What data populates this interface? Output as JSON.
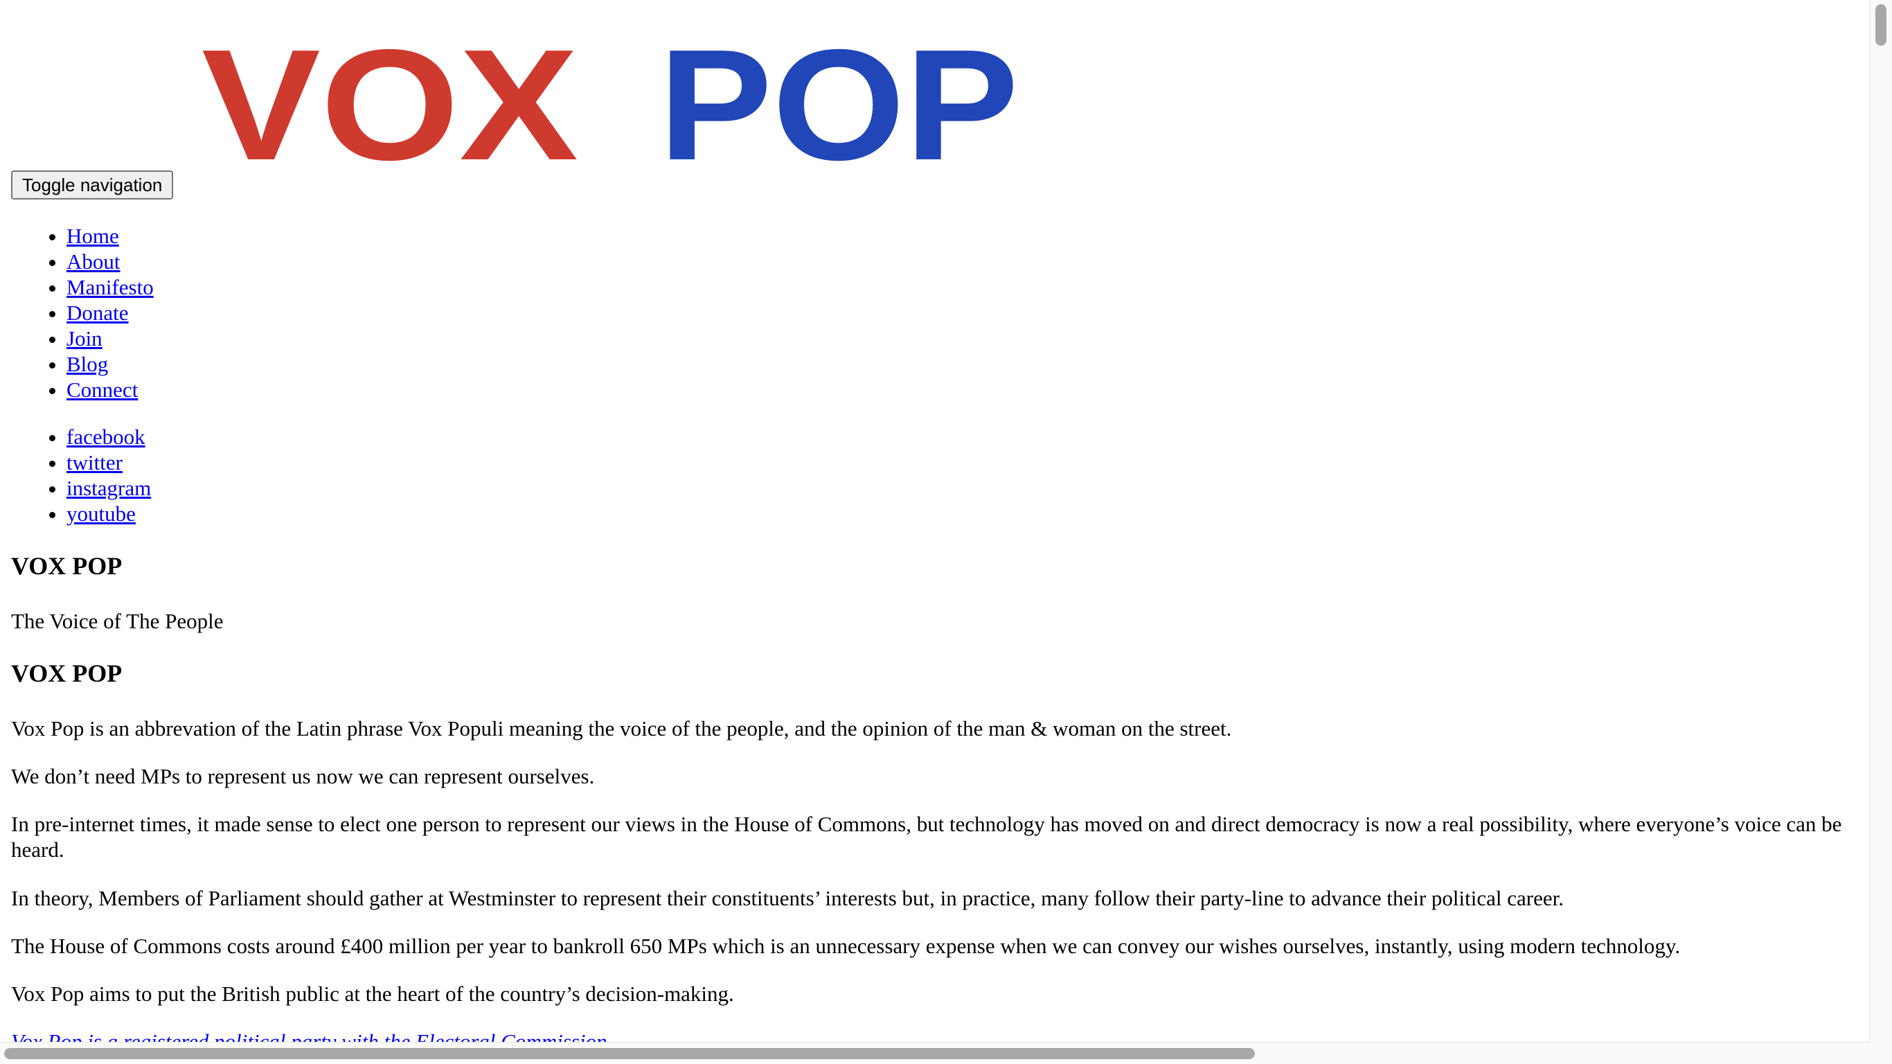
{
  "logo": {
    "text": "VOX POP",
    "word1": "VOX",
    "word2": "POP",
    "colors": {
      "word1": "#cf3a2e",
      "word2": "#2046b8"
    }
  },
  "toggle": {
    "label": "Toggle navigation"
  },
  "nav": {
    "items": [
      "Home",
      "About",
      "Manifesto",
      "Donate",
      "Join",
      "Blog",
      "Connect"
    ]
  },
  "social": {
    "items": [
      "facebook",
      "twitter",
      "instagram",
      "youtube"
    ]
  },
  "header": {
    "title": "VOX POP",
    "tagline": "The Voice of The People"
  },
  "main": {
    "title": "VOX POP",
    "paragraphs": [
      "Vox Pop is an abbrevation of the Latin phrase Vox Populi meaning the voice of the people, and the opinion of the man & woman on the street.",
      "We don’t need MPs to represent us now we can represent ourselves.",
      "In pre-internet times, it made sense to elect one person to represent our views in the House of Commons, but technology has moved on and direct democracy is now a real possibility, where everyone’s voice can be heard.",
      "In theory, Members of Parliament should gather at Westminster to represent their constituents’ interests but, in practice, many follow their party-line to advance their political career.",
      "The House of Commons costs around £400 million per year to bankroll 650 MPs which is an unnecessary expense when we can convey our wishes ourselves, instantly, using modern technology.",
      "Vox Pop aims to put the British public at the heart of the country’s decision-making."
    ],
    "registered": "Vox Pop is a registered political party with the Electoral Commission"
  },
  "colors": {
    "link": "#0000ee",
    "text": "#000000",
    "background": "#ffffff"
  }
}
